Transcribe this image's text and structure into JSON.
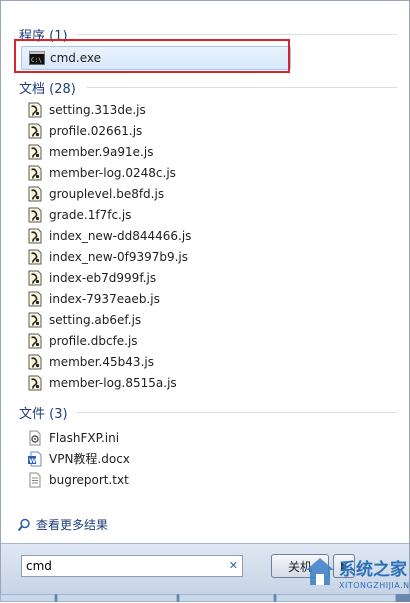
{
  "sections": {
    "programs": {
      "header": "程序 (1)"
    },
    "documents": {
      "header": "文档 (28)"
    },
    "files": {
      "header": "文件 (3)"
    }
  },
  "programs": [
    {
      "label": "cmd.exe",
      "icon": "cmd-icon"
    }
  ],
  "documents": [
    {
      "label": "setting.313de.js",
      "icon": "js-file-icon"
    },
    {
      "label": "profile.02661.js",
      "icon": "js-file-icon"
    },
    {
      "label": "member.9a91e.js",
      "icon": "js-file-icon"
    },
    {
      "label": "member-log.0248c.js",
      "icon": "js-file-icon"
    },
    {
      "label": "grouplevel.be8fd.js",
      "icon": "js-file-icon"
    },
    {
      "label": "grade.1f7fc.js",
      "icon": "js-file-icon"
    },
    {
      "label": "index_new-dd844466.js",
      "icon": "js-file-icon"
    },
    {
      "label": "index_new-0f9397b9.js",
      "icon": "js-file-icon"
    },
    {
      "label": "index-eb7d999f.js",
      "icon": "js-file-icon"
    },
    {
      "label": "index-7937eaeb.js",
      "icon": "js-file-icon"
    },
    {
      "label": "setting.ab6ef.js",
      "icon": "js-file-icon"
    },
    {
      "label": "profile.dbcfe.js",
      "icon": "js-file-icon"
    },
    {
      "label": "member.45b43.js",
      "icon": "js-file-icon"
    },
    {
      "label": "member-log.8515a.js",
      "icon": "js-file-icon"
    }
  ],
  "files": [
    {
      "label": "FlashFXP.ini",
      "icon": "ini-settings-icon"
    },
    {
      "label": "VPN教程.docx",
      "icon": "word-doc-icon"
    },
    {
      "label": "bugreport.txt",
      "icon": "txt-file-icon"
    }
  ],
  "more_results": {
    "label": "查看更多结果",
    "icon": "magnifier-icon"
  },
  "search": {
    "value": "cmd",
    "clear_icon": "close-icon"
  },
  "shutdown": {
    "label": "关机",
    "arrow_icon": "triangle-right-icon"
  },
  "watermark": {
    "brand": "系统之家",
    "sub": "XITONGZHIJIA.NET"
  },
  "colors": {
    "highlight_border": "#d6262b",
    "selection_bg": "#dbe9fb",
    "header_text": "#1d3d7a",
    "bottom_bar": "#cfdbeb"
  }
}
